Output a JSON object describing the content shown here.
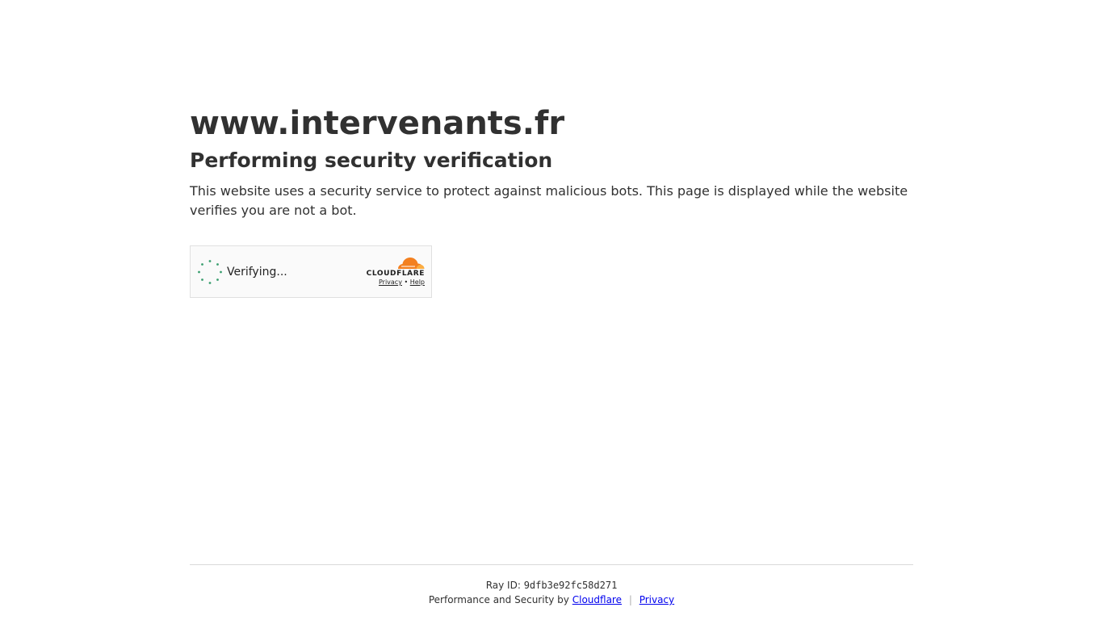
{
  "page": {
    "site_title": "www.intervenants.fr",
    "subtitle": "Performing security verification",
    "description": "This website uses a security service to protect against malicious bots. This page is displayed while the website verifies you are not a bot."
  },
  "widget": {
    "status_text": "Verifying...",
    "brand": "CLOUDFLARE",
    "privacy_link": "Privacy",
    "link_separator": "•",
    "help_link": "Help",
    "spinner_color": "#3a9f6f",
    "logo_color": "#f38020",
    "logo_color_light": "#fbad41"
  },
  "footer": {
    "ray_id_label": "Ray ID:",
    "ray_id_value": "9dfb3e92fc58d271",
    "performance_text": "Performance and Security by",
    "cloudflare_link": "Cloudflare",
    "separator": "|",
    "privacy_link": "Privacy"
  }
}
